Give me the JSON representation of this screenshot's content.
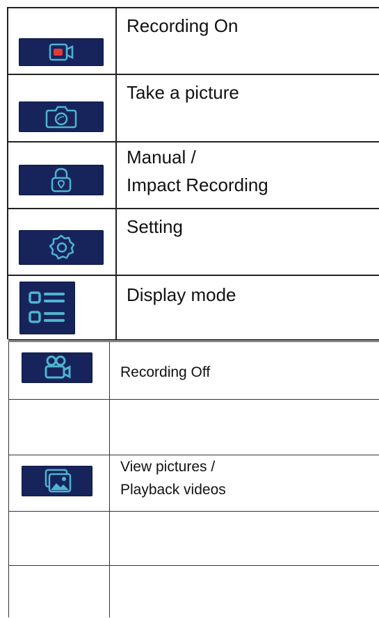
{
  "colors": {
    "tile_bg": "#17245c",
    "icon_line": "#4fb4cf",
    "record_dot": "#e23a3a"
  },
  "top_table": {
    "rows": [
      {
        "icon": "record-camera-icon",
        "label": "Recording On"
      },
      {
        "icon": "camera-icon",
        "label": "Take a picture"
      },
      {
        "icon": "lock-icon",
        "label_line1": "Manual /",
        "label_line2": "Impact Recording"
      },
      {
        "icon": "gear-icon",
        "label": "Setting"
      },
      {
        "icon": "list-icon",
        "label": "Display mode"
      }
    ]
  },
  "bottom_table": {
    "rows": [
      {
        "icon": "video-camera-icon",
        "label": "Recording Off"
      },
      {
        "icon": "",
        "label": ""
      },
      {
        "icon": "gallery-icon",
        "label_line1": "View pictures /",
        "label_line2": "Playback videos"
      },
      {
        "icon": "",
        "label": ""
      },
      {
        "icon": "",
        "label": ""
      }
    ]
  }
}
